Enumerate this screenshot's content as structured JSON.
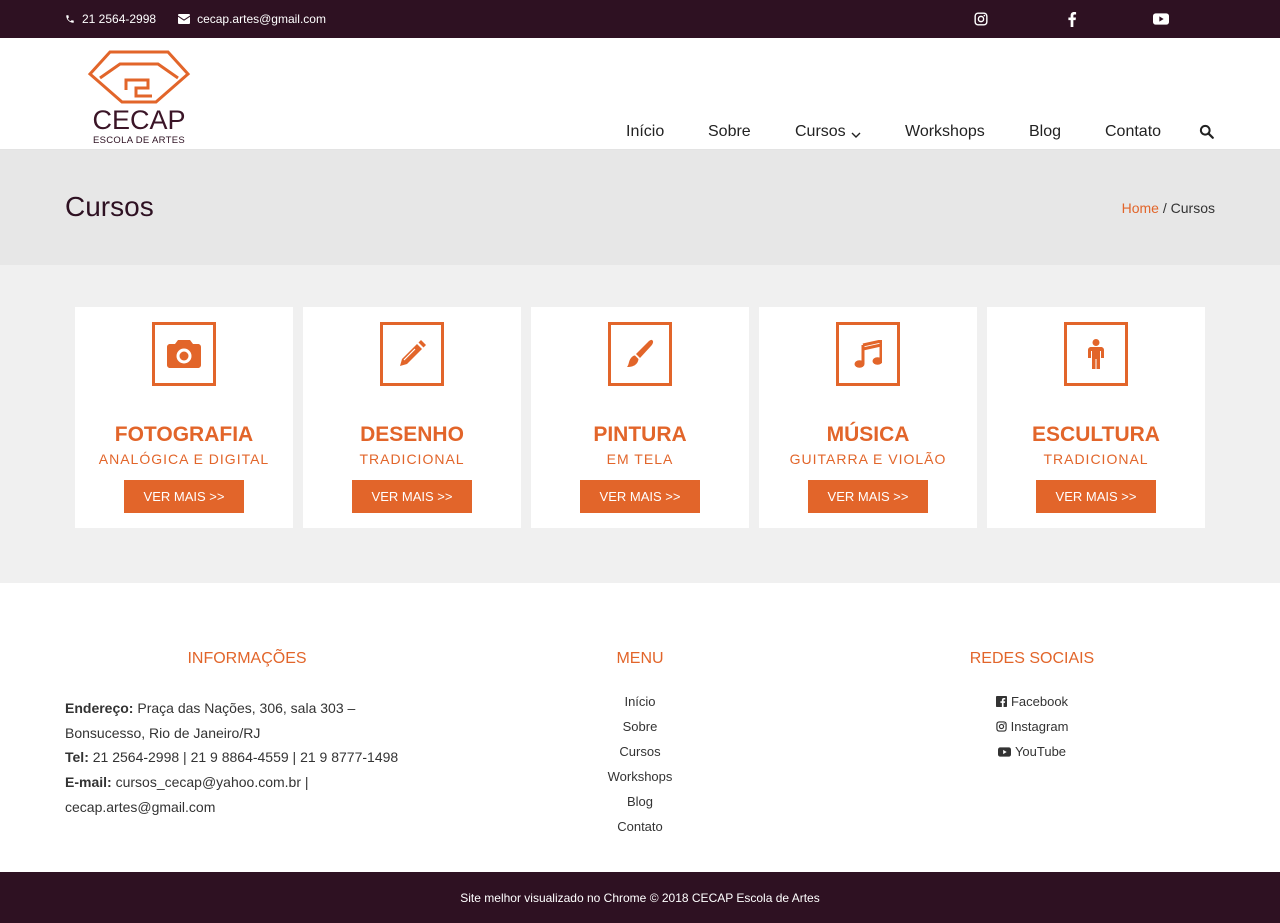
{
  "topbar": {
    "phone": "21 2564-2998",
    "email": "cecap.artes@gmail.com",
    "socials": [
      "instagram-icon",
      "facebook-icon",
      "youtube-icon"
    ]
  },
  "logo": {
    "brand": "CECAP",
    "tagline": "ESCOLA DE ARTES"
  },
  "nav": {
    "items": [
      "Início",
      "Sobre",
      "Cursos",
      "Workshops",
      "Blog",
      "Contato"
    ],
    "dropdown_item": "Cursos"
  },
  "page": {
    "title": "Cursos",
    "breadcrumb": {
      "home": "Home",
      "separator": "/",
      "current": "Cursos"
    }
  },
  "courses": [
    {
      "icon": "camera-icon",
      "name": "FOTOGRAFIA",
      "sub": "ANALÓGICA E DIGITAL",
      "button": "VER MAIS >>"
    },
    {
      "icon": "pencil-icon",
      "name": "DESENHO",
      "sub": "TRADICIONAL",
      "button": "VER MAIS >>"
    },
    {
      "icon": "paintbrush-icon",
      "name": "PINTURA",
      "sub": "EM TELA",
      "button": "VER MAIS >>"
    },
    {
      "icon": "music-icon",
      "name": "MÚSICA",
      "sub": "GUITARRA E VIOLÃO",
      "button": "VER MAIS >>"
    },
    {
      "icon": "person-icon",
      "name": "ESCULTURA",
      "sub": "TRADICIONAL",
      "button": "VER MAIS >>"
    }
  ],
  "footer": {
    "info_title": "INFORMAÇÕES",
    "address_label": "Endereço:",
    "address": "Praça das Nações, 306, sala 303 – Bonsucesso, Rio de Janeiro/RJ",
    "tel_label": "Tel:",
    "tel": "21 2564-2998 | 21 9 8864-4559 | 21 9 8777-1498",
    "email_label": "E-mail:",
    "email": "cursos_cecap@yahoo.com.br | cecap.artes@gmail.com",
    "menu_title": "MENU",
    "menu_items": [
      "Início",
      "Sobre",
      "Cursos",
      "Workshops",
      "Blog",
      "Contato"
    ],
    "social_title": "REDES SOCIAIS",
    "social_items": [
      {
        "icon": "facebook-square-icon",
        "label": "Facebook"
      },
      {
        "icon": "instagram-icon",
        "label": "Instagram"
      },
      {
        "icon": "youtube-icon",
        "label": "YouTube"
      }
    ]
  },
  "bottom": {
    "text": "Site melhor visualizado no Chrome © 2018 CECAP Escola de Artes"
  },
  "colors": {
    "accent": "#e2652a",
    "dark": "#2e1122",
    "title_bg": "#e7e7e7"
  }
}
